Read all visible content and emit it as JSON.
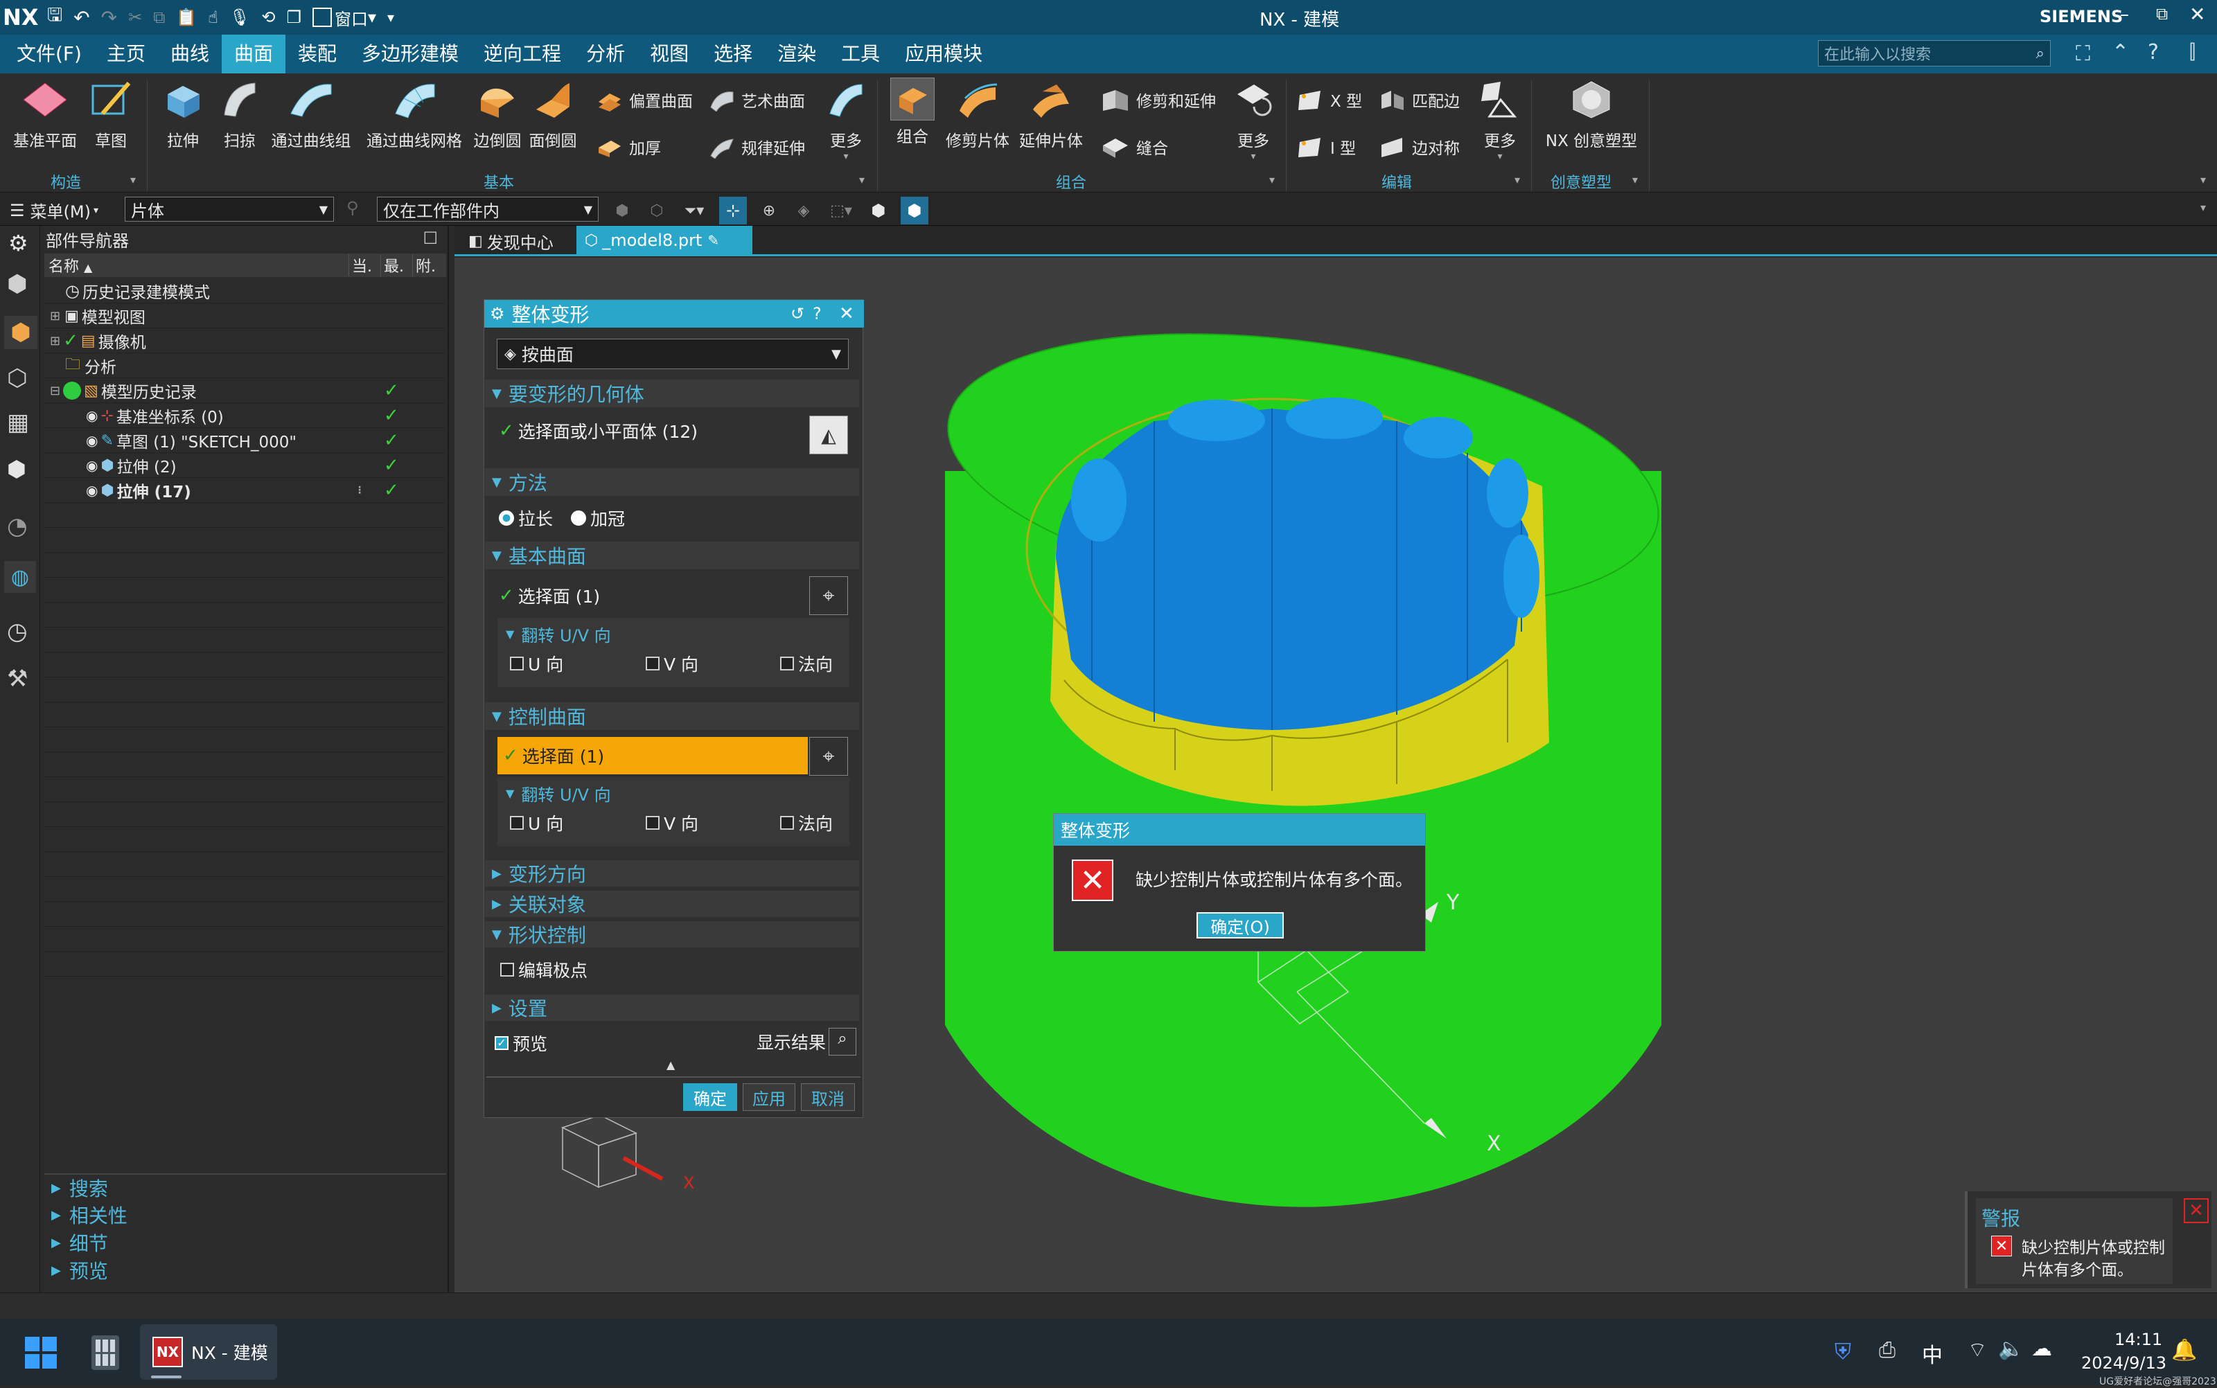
{
  "app": {
    "logo": "NX",
    "title": "NX - 建模",
    "brand": "SIEMENS",
    "window_menu": "窗口",
    "search_placeholder": "在此输入以搜索"
  },
  "menu": [
    "文件(F)",
    "主页",
    "曲线",
    "曲面",
    "装配",
    "多边形建模",
    "逆向工程",
    "分析",
    "视图",
    "选择",
    "渲染",
    "工具",
    "应用模块"
  ],
  "menu_active": "曲面",
  "ribbon": {
    "tools_construct": [
      "基准平面",
      "草图"
    ],
    "tools_basic_large": [
      "拉伸",
      "扫掠",
      "通过曲线组",
      "通过曲线网格",
      "边倒圆",
      "面倒圆"
    ],
    "tools_basic_small": [
      "偏置曲面",
      "艺术曲面",
      "加厚",
      "规律延伸"
    ],
    "more": "更多",
    "tools_combine_large": [
      "组合",
      "修剪片体",
      "延伸片体"
    ],
    "tools_combine_small": [
      "修剪和延伸",
      "缝合"
    ],
    "tools_edit_small": [
      "X 型",
      "匹配边",
      "I 型",
      "边对称"
    ],
    "tools_creative": [
      "NX 创意塑型"
    ],
    "groups": [
      "构造",
      "基本",
      "组合",
      "编辑",
      "创意塑型"
    ]
  },
  "selection_bar": {
    "menu_label": "菜单(M)",
    "filter": "片体",
    "scope": "仅在工作部件内"
  },
  "navigator": {
    "title": "部件导航器",
    "columns": [
      "名称",
      "当.",
      "最.",
      "附."
    ],
    "rows": [
      {
        "label": "历史记录建模模式",
        "checked": false,
        "bold": false
      },
      {
        "label": "模型视图",
        "checked": false,
        "bold": false
      },
      {
        "label": "摄像机",
        "checked": false,
        "bold": false
      },
      {
        "label": "分析",
        "checked": false,
        "bold": false
      },
      {
        "label": "模型历史记录",
        "checked": true,
        "bold": false
      },
      {
        "label": "基准坐标系 (0)",
        "checked": true,
        "bold": false
      },
      {
        "label": "草图 (1) \"SKETCH_000\"",
        "checked": true,
        "bold": false
      },
      {
        "label": "拉伸 (2)",
        "checked": true,
        "bold": false
      },
      {
        "label": "拉伸 (17)",
        "checked": true,
        "bold": true
      }
    ],
    "bottom_sections": [
      "搜索",
      "相关性",
      "细节",
      "预览"
    ]
  },
  "tabs": [
    "发现中心",
    "_model8.prt"
  ],
  "dialog": {
    "title": "整体变形",
    "type_value": "按曲面",
    "sections": {
      "geometry": "要变形的几何体",
      "geometry_select": "选择面或小平面体 (12)",
      "method": "方法",
      "method_options": [
        "拉长",
        "加冠"
      ],
      "method_selected": "拉长",
      "base_surface": "基本曲面",
      "base_select": "选择面 (1)",
      "flip_uv": "翻转 U/V 向",
      "flip_options": [
        "U 向",
        "V 向",
        "法向"
      ],
      "control_surface": "控制曲面",
      "control_select": "选择面 (1)",
      "deform_direction": "变形方向",
      "related_objects": "关联对象",
      "shape_control": "形状控制",
      "edit_poles": "编辑极点",
      "settings": "设置",
      "preview": "预览",
      "show_result": "显示结果"
    },
    "buttons": {
      "ok": "确定",
      "apply": "应用",
      "cancel": "取消"
    }
  },
  "error_popup": {
    "title": "整体变形",
    "message": "缺少控制片体或控制片体有多个面。",
    "ok": "确定(O)"
  },
  "alert": {
    "title": "警报",
    "message": "缺少控制片体或控制片体有多个面。"
  },
  "axes": {
    "x": "X",
    "y": "Y"
  },
  "taskbar": {
    "app_label": "NX - 建模",
    "ime": "中",
    "time": "14:11",
    "date": "2024/9/13",
    "watermark": "UG爱好者论坛@强哥2023"
  },
  "colors": {
    "accent": "#2aa6c9",
    "model_green": "#22d11e",
    "model_blue": "#1380d6",
    "model_yellow": "#d6d219",
    "highlight": "#f5a70a"
  }
}
